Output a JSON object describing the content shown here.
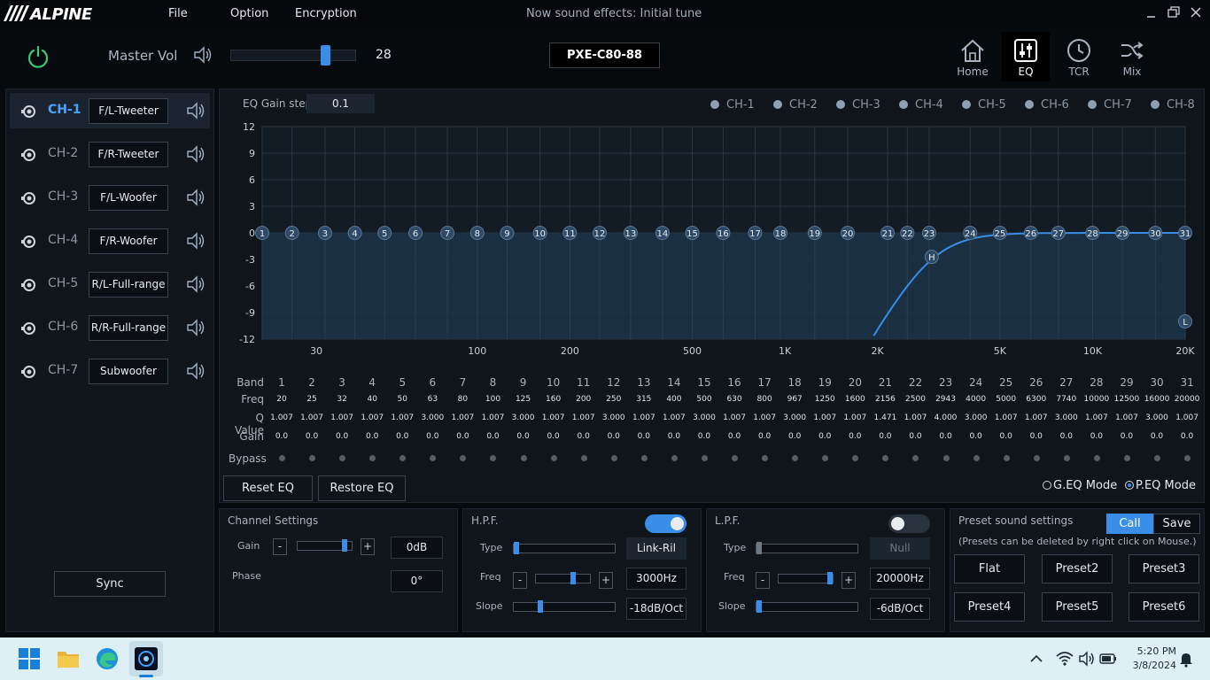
{
  "app": {
    "brand": "ALPINE",
    "menus": [
      "File",
      "Option",
      "Encryption"
    ],
    "now_sound": "Now sound effects: Initial tune"
  },
  "master": {
    "label": "Master Vol",
    "value": "28",
    "level_fraction": 0.78
  },
  "device": "PXE-C80-88",
  "nav": [
    {
      "label": "Home",
      "icon": "home-icon"
    },
    {
      "label": "EQ",
      "icon": "eq-sliders-icon",
      "active": true
    },
    {
      "label": "TCR",
      "icon": "clock-icon"
    },
    {
      "label": "Mix",
      "icon": "shuffle-icon"
    }
  ],
  "channels": [
    {
      "name": "CH-1",
      "label": "F/L-Tweeter",
      "selected": true
    },
    {
      "name": "CH-2",
      "label": "F/R-Tweeter"
    },
    {
      "name": "CH-3",
      "label": "F/L-Woofer"
    },
    {
      "name": "CH-4",
      "label": "F/R-Woofer"
    },
    {
      "name": "CH-5",
      "label": "R/L-Full-range"
    },
    {
      "name": "CH-6",
      "label": "R/R-Full-range"
    },
    {
      "name": "CH-7",
      "label": "Subwoofer"
    }
  ],
  "sync_label": "Sync",
  "eq": {
    "gain_step_label": "EQ Gain step",
    "gain_step_value": "0.1",
    "legend": [
      "CH-1",
      "CH-2",
      "CH-3",
      "CH-4",
      "CH-5",
      "CH-6",
      "CH-7",
      "CH-8"
    ],
    "y_ticks": [
      "12",
      "9",
      "6",
      "3",
      "0",
      "-3",
      "-6",
      "-9",
      "-12"
    ],
    "x_tick_labels": [
      {
        "label": "30",
        "freq": 30
      },
      {
        "label": "100",
        "freq": 100
      },
      {
        "label": "200",
        "freq": 200
      },
      {
        "label": "500",
        "freq": 500
      },
      {
        "label": "1K",
        "freq": 1000
      },
      {
        "label": "2K",
        "freq": 2000
      },
      {
        "label": "5K",
        "freq": 5000
      },
      {
        "label": "10K",
        "freq": 10000
      },
      {
        "label": "20K",
        "freq": 20000
      }
    ],
    "hpf_marker": "H",
    "lpf_marker": "L",
    "row_labels": {
      "band": "Band",
      "freq": "Freq",
      "q": "Q Value",
      "gain": "Gain",
      "bypass": "Bypass"
    },
    "bands": [
      "1",
      "2",
      "3",
      "4",
      "5",
      "6",
      "7",
      "8",
      "9",
      "10",
      "11",
      "12",
      "13",
      "14",
      "15",
      "16",
      "17",
      "18",
      "19",
      "20",
      "21",
      "22",
      "23",
      "24",
      "25",
      "26",
      "27",
      "28",
      "29",
      "30",
      "31"
    ],
    "freqs": [
      "20",
      "25",
      "32",
      "40",
      "50",
      "63",
      "80",
      "100",
      "125",
      "160",
      "200",
      "250",
      "315",
      "400",
      "500",
      "630",
      "800",
      "967",
      "1250",
      "1600",
      "2156",
      "2500",
      "2943",
      "4000",
      "5000",
      "6300",
      "7740",
      "10000",
      "12500",
      "16000",
      "20000"
    ],
    "q_values": [
      "1.007",
      "1.007",
      "1.007",
      "1.007",
      "1.007",
      "3.000",
      "1.007",
      "1.007",
      "3.000",
      "1.007",
      "1.007",
      "3.000",
      "1.007",
      "1.007",
      "3.000",
      "1.007",
      "1.007",
      "3.000",
      "1.007",
      "1.007",
      "1.471",
      "1.007",
      "4.000",
      "3.000",
      "1.007",
      "1.007",
      "3.000",
      "1.007",
      "1.007",
      "3.000",
      "1.007"
    ],
    "gains": [
      "0.0",
      "0.0",
      "0.0",
      "0.0",
      "0.0",
      "0.0",
      "0.0",
      "0.0",
      "0.0",
      "0.0",
      "0.0",
      "0.0",
      "0.0",
      "0.0",
      "0.0",
      "0.0",
      "0.0",
      "0.0",
      "0.0",
      "0.0",
      "0.0",
      "0.0",
      "0.0",
      "0.0",
      "0.0",
      "0.0",
      "0.0",
      "0.0",
      "0.0",
      "0.0",
      "0.0"
    ],
    "reset_label": "Reset EQ",
    "restore_label": "Restore EQ",
    "geq_label": "G.EQ Mode",
    "peq_label": "P.EQ Mode",
    "mode": "P.EQ"
  },
  "channel_settings": {
    "title": "Channel Settings",
    "gain_label": "Gain",
    "gain_value": "0dB",
    "gain_fraction": 0.9,
    "phase_label": "Phase",
    "phase_value": "0°"
  },
  "hpf": {
    "title": "H.P.F.",
    "enabled": true,
    "type_label": "Type",
    "type_value": "Link-Ril",
    "type_fraction": 0.0,
    "freq_label": "Freq",
    "freq_value": "3000Hz",
    "freq_fraction": 0.7,
    "slope_label": "Slope",
    "slope_value": "-18dB/Oct",
    "slope_fraction": 0.25
  },
  "lpf": {
    "title": "L.P.F.",
    "enabled": false,
    "type_label": "Type",
    "type_value": "Null",
    "type_fraction": 0.0,
    "freq_label": "Freq",
    "freq_value": "20000Hz",
    "freq_fraction": 1.0,
    "slope_label": "Slope",
    "slope_value": "-6dB/Oct",
    "slope_fraction": 0.0
  },
  "presets": {
    "title": "Preset sound settings",
    "call_label": "Call",
    "save_label": "Save",
    "hint": "(Presets can be deleted by right click on Mouse.)",
    "buttons": [
      "Flat",
      "Preset2",
      "Preset3",
      "Preset4",
      "Preset5",
      "Preset6"
    ]
  },
  "taskbar": {
    "time": "5:20 PM",
    "date": "3/8/2024"
  },
  "colors": {
    "accent": "#3a8ee8",
    "active_channel": "#4aa3ff",
    "curve": "#3a8ee8"
  }
}
